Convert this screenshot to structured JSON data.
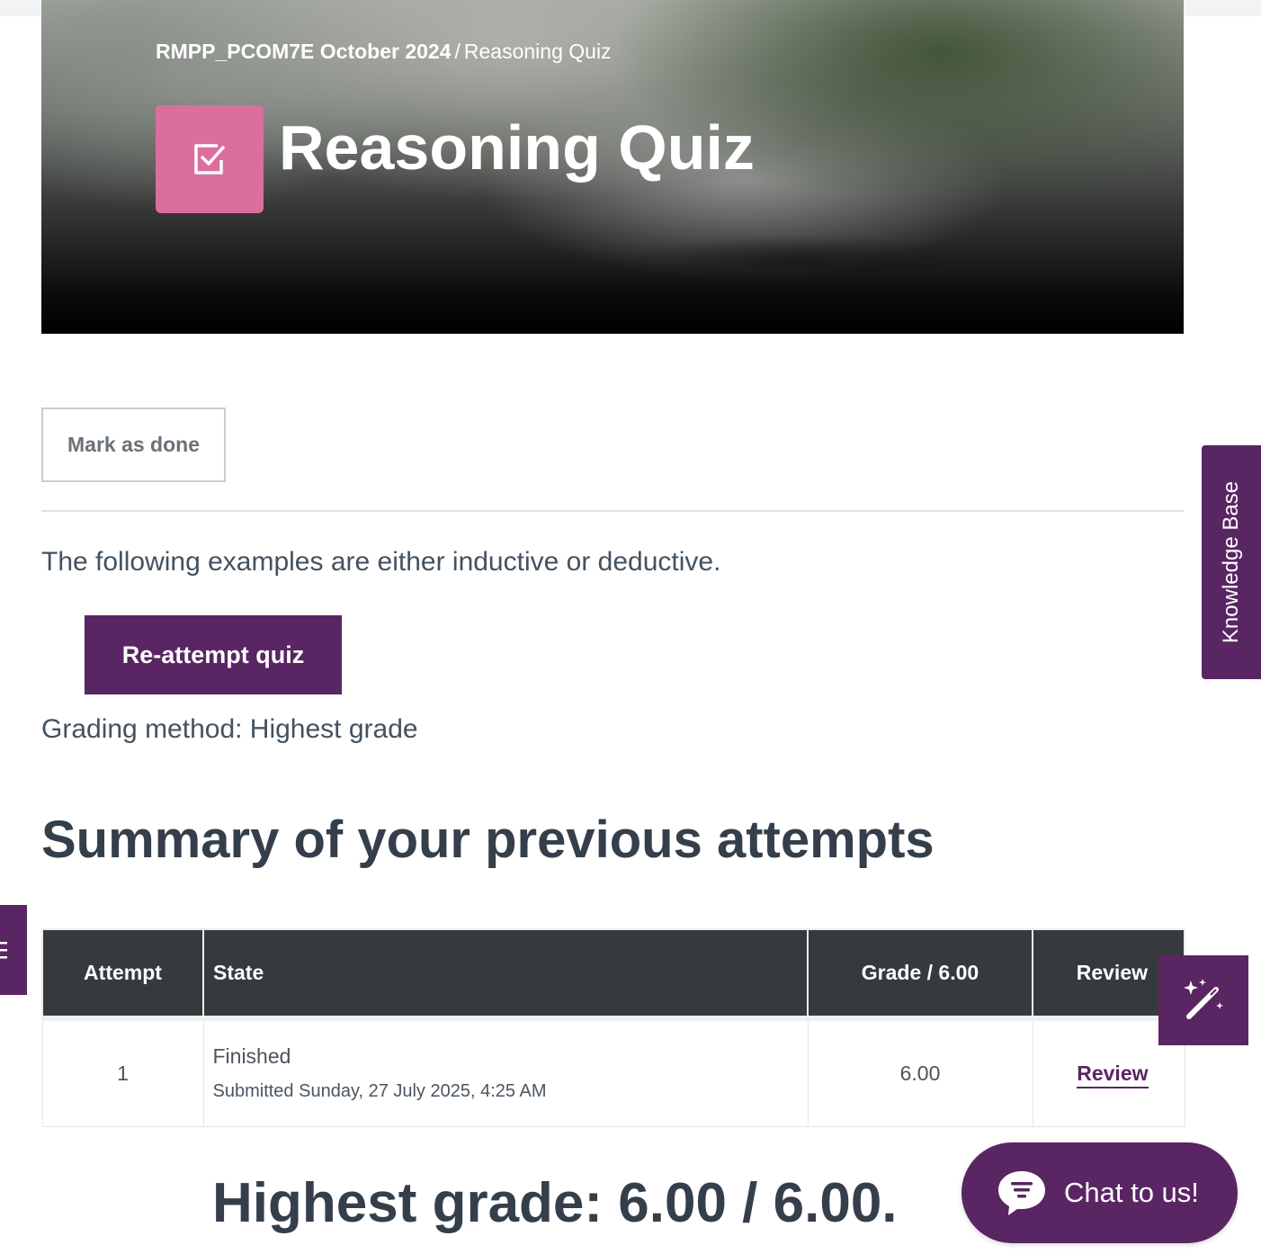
{
  "header": {
    "breadcrumb_course": "RMPP_PCOM7E October 2024",
    "breadcrumb_separator": "/",
    "breadcrumb_current": "Reasoning Quiz",
    "title": "Reasoning Quiz",
    "icon": "checkbox-icon",
    "icon_color": "#db6e9f"
  },
  "actions": {
    "mark_done_label": "Mark as done",
    "reattempt_label": "Re-attempt quiz"
  },
  "content": {
    "intro": "The following examples are either inductive or deductive.",
    "grading_method": "Grading method: Highest grade",
    "summary_heading": "Summary of your previous attempts"
  },
  "table": {
    "headers": [
      "Attempt",
      "State",
      "Grade / 6.00",
      "Review"
    ],
    "rows": [
      {
        "attempt": "1",
        "state": "Finished",
        "submitted": "Submitted Sunday, 27 July 2025, 4:25 AM",
        "grade": "6.00",
        "review": "Review"
      }
    ]
  },
  "result": {
    "highest_grade": "Highest grade: 6.00 / 6.00."
  },
  "widgets": {
    "knowledge_base_label": "Knowledge Base",
    "chat_label": "Chat to us!",
    "drawer_icon": "menu-icon",
    "magic_icon": "magic-wand-icon",
    "chat_icon": "chat-bubble-icon"
  },
  "colors": {
    "brand_purple": "#5a2563",
    "table_header": "#373a3c",
    "heading_text": "#343f4b"
  }
}
